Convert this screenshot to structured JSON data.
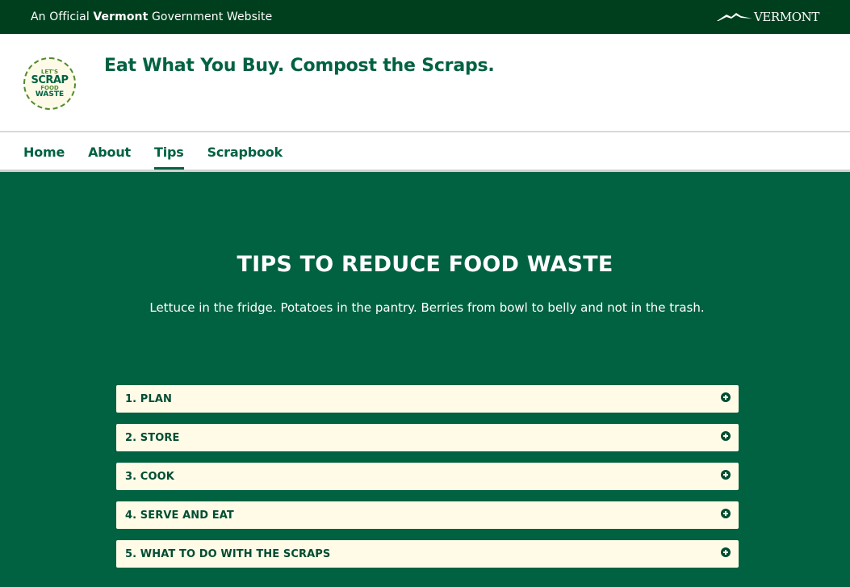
{
  "gov_bar": {
    "prefix": "An Official ",
    "state": "Vermont",
    "suffix": " Government Website",
    "logo_text": "VERMONT"
  },
  "header": {
    "logo_lines": [
      "LET'S",
      "SCRAP",
      "FOOD",
      "WASTE"
    ],
    "title": "Eat What You Buy. Compost the Scraps."
  },
  "nav": {
    "items": [
      {
        "label": "Home",
        "active": false
      },
      {
        "label": "About",
        "active": false
      },
      {
        "label": "Tips",
        "active": true
      },
      {
        "label": "Scrapbook",
        "active": false
      }
    ]
  },
  "main": {
    "heading": "TIPS TO REDUCE FOOD WASTE",
    "intro": "Lettuce in the fridge. Potatoes in the pantry. Berries from bowl to belly and not in the trash.",
    "accordion": [
      {
        "label": "1. PLAN",
        "icon": "plus-circle-icon"
      },
      {
        "label": "2. STORE",
        "icon": "plus-circle-icon"
      },
      {
        "label": "3. COOK",
        "icon": "plus-circle-icon"
      },
      {
        "label": "4. SERVE AND EAT",
        "icon": "plus-circle-icon"
      },
      {
        "label": "5. WHAT TO DO WITH THE SCRAPS",
        "icon": "plus-circle-icon"
      }
    ]
  },
  "colors": {
    "gov_bar": "#003f1e",
    "brand_green": "#006241",
    "accordion_bg": "#fffbe6"
  }
}
